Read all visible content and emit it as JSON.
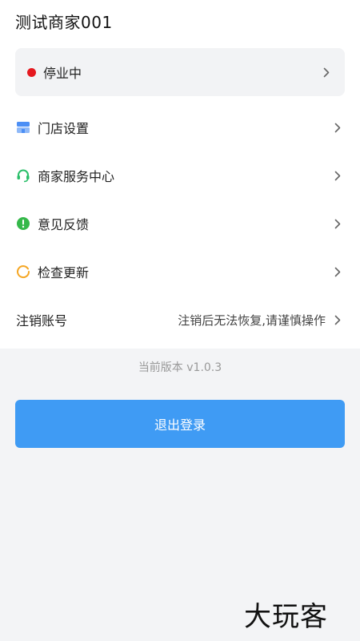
{
  "header": {
    "title": "测试商家001"
  },
  "status": {
    "label": "停业中",
    "dot_color": "#e5191f"
  },
  "menu": [
    {
      "label": "门店设置",
      "icon": "store-icon"
    },
    {
      "label": "商家服务中心",
      "icon": "headset-icon"
    },
    {
      "label": "意见反馈",
      "icon": "feedback-icon"
    },
    {
      "label": "检查更新",
      "icon": "update-icon"
    }
  ],
  "account": {
    "label": "注销账号",
    "hint": "注销后无法恢复,请谨慎操作"
  },
  "version": {
    "text": "当前版本 v1.0.3"
  },
  "logout": {
    "label": "退出登录",
    "color": "#3f9bf4"
  },
  "watermark": {
    "text": "大玩客"
  }
}
